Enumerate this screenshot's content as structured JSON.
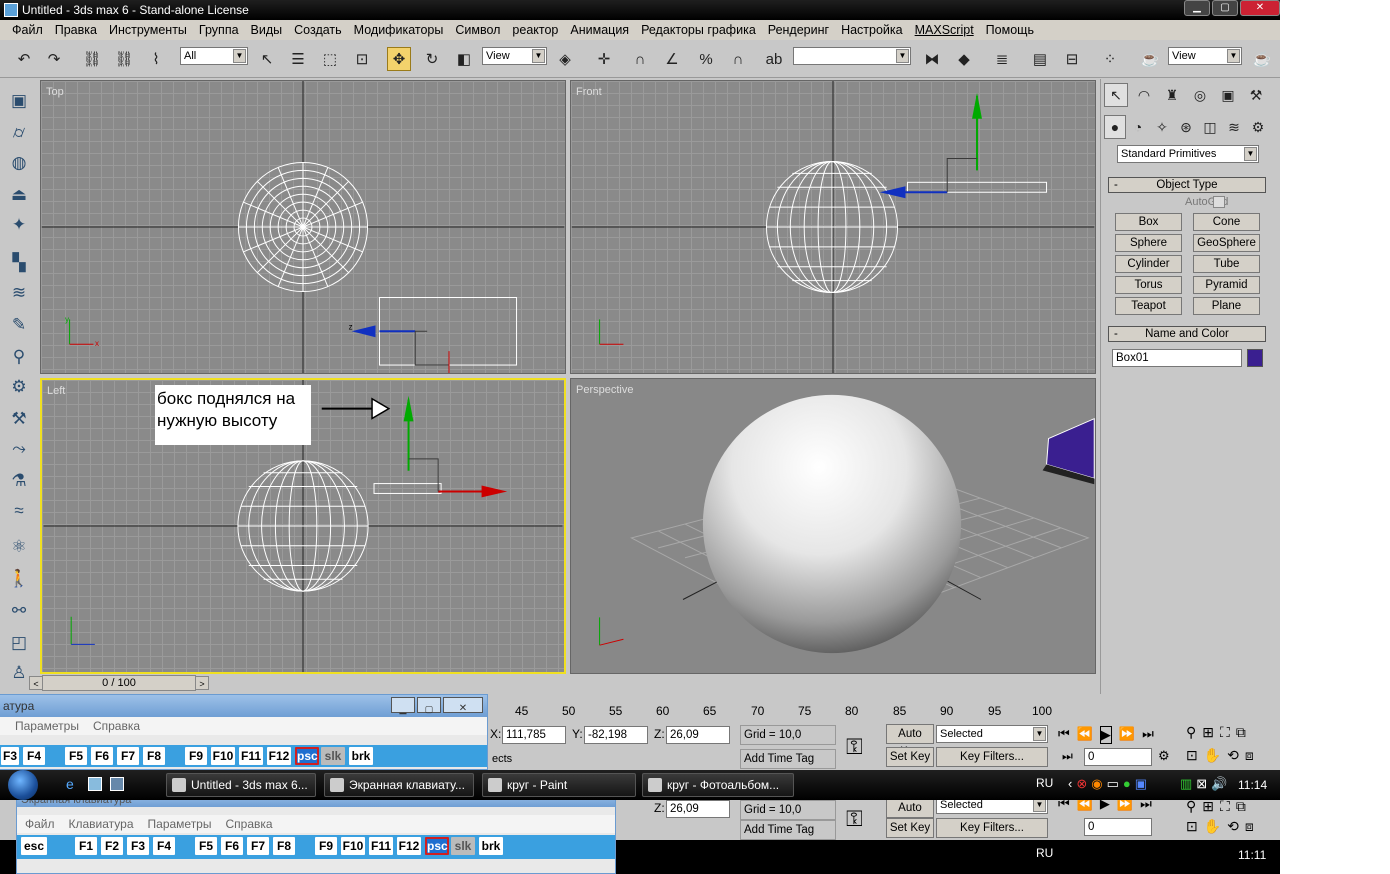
{
  "window": {
    "title": "Untitled - 3ds max 6 - Stand-alone License"
  },
  "menu": [
    "Файл",
    "Правка",
    "Инструменты",
    "Группа",
    "Виды",
    "Создать",
    "Модификаторы",
    "Символ",
    "реактор",
    "Анимация",
    "Редакторы графика",
    "Рендеринг",
    "Настройка",
    "MAXScript",
    "Помощь"
  ],
  "toolbar": {
    "selection_filter": "All",
    "ref_coord": "View",
    "named_sel": "",
    "render_view": "View"
  },
  "viewports": {
    "top": {
      "label": "Top"
    },
    "front": {
      "label": "Front"
    },
    "left": {
      "label": "Left",
      "annotation_line1": "бокс поднялся на",
      "annotation_line2": "нужную высоту"
    },
    "perspective": {
      "label": "Perspective"
    }
  },
  "axes": {
    "x": "x",
    "y": "y",
    "z": "z"
  },
  "command_panel": {
    "category": "Standard Primitives",
    "object_type_title": "Object Type",
    "autogrid": "AutoGrid",
    "buttons": [
      "Box",
      "Cone",
      "Sphere",
      "GeoSphere",
      "Cylinder",
      "Tube",
      "Torus",
      "Pyramid",
      "Teapot",
      "Plane"
    ],
    "name_color_title": "Name and Color",
    "object_name": "Box01",
    "object_color": "#3a1f90",
    "minus": "-"
  },
  "timeline": {
    "frame": "0 / 100",
    "ticks": [
      "45",
      "50",
      "55",
      "60",
      "65",
      "70",
      "75",
      "80",
      "85",
      "90",
      "95",
      "100"
    ]
  },
  "status": {
    "x_label": "X:",
    "x": "111,785",
    "y_label": "Y:",
    "y": "-82,198",
    "z_label": "Z:",
    "z": "26,09",
    "grid": "Grid = 10,0",
    "add_time_tag": "Add Time Tag",
    "auto_key": "Auto Key",
    "set_key": "Set Key",
    "selected": "Selected",
    "key_filters": "Key Filters...",
    "frame_field": "0",
    "partial_text": "ects"
  },
  "keyboard": {
    "title_partial": "атура",
    "menu": [
      "Параметры",
      "Справка"
    ],
    "keys": [
      "F3",
      "F4",
      "F5",
      "F6",
      "F7",
      "F8",
      "F9",
      "F10",
      "F11",
      "F12",
      "psc",
      "slk",
      "brk"
    ]
  },
  "taskbar": {
    "tasks": [
      "Untitled - 3ds max 6...",
      "Экранная клавиату...",
      "круг - Paint",
      "круг - Фотоальбом..."
    ],
    "lang": "RU",
    "time": "11:14"
  },
  "ghost": {
    "grid": "Grid = 10,0",
    "add_time_tag": "Add Time Tag",
    "auto_key": "Auto Key",
    "set_key": "Set Key",
    "selected": "Selected",
    "key_filters": "Key Filters...",
    "frame_field": "0",
    "z_label": "Z:",
    "z": "26,09",
    "kb_title": "Экранная клавиатура",
    "kb_menu": [
      "Файл",
      "Клавиатура",
      "Параметры",
      "Справка"
    ],
    "kb_keys": [
      "esc",
      "F1",
      "F2",
      "F3",
      "F4",
      "F5",
      "F6",
      "F7",
      "F8",
      "F9",
      "F10",
      "F11",
      "F12",
      "psc",
      "slk",
      "brk"
    ],
    "lang": "RU",
    "time": "11:11"
  }
}
